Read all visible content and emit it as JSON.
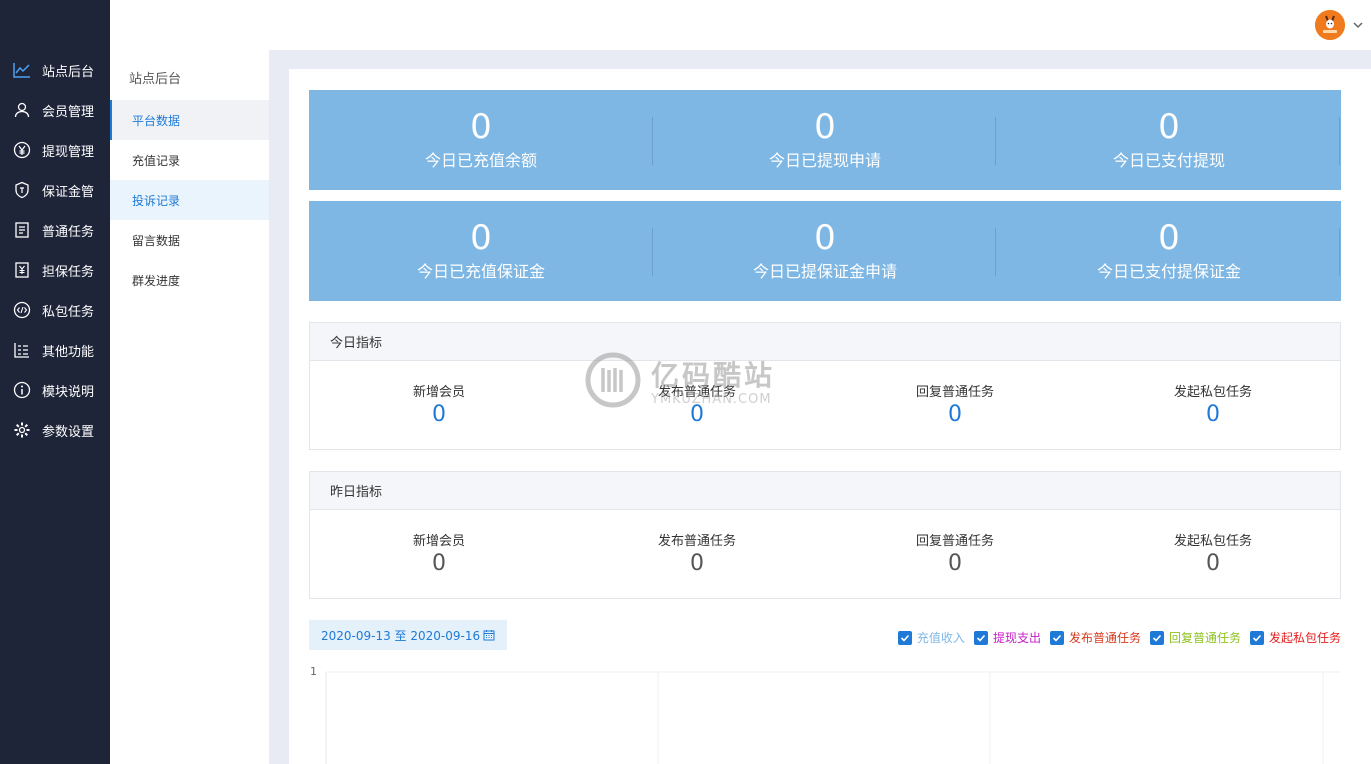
{
  "sidebar": {
    "items": [
      {
        "label": "站点后台",
        "icon": "chart-line-icon"
      },
      {
        "label": "会员管理",
        "icon": "user-icon"
      },
      {
        "label": "提现管理",
        "icon": "yen-circle-icon"
      },
      {
        "label": "保证金管",
        "icon": "shield-icon"
      },
      {
        "label": "普通任务",
        "icon": "receipt-icon"
      },
      {
        "label": "担保任务",
        "icon": "yen-receipt-icon"
      },
      {
        "label": "私包任务",
        "icon": "code-circle-icon"
      },
      {
        "label": "其他功能",
        "icon": "list-icon"
      },
      {
        "label": "模块说明",
        "icon": "info-circle-icon"
      },
      {
        "label": "参数设置",
        "icon": "gear-icon"
      }
    ]
  },
  "subnav": {
    "title": "站点后台",
    "items": [
      "平台数据",
      "充值记录",
      "投诉记录",
      "留言数据",
      "群发进度"
    ]
  },
  "stats_row1": [
    {
      "value": "0",
      "caption": "今日已充值余额"
    },
    {
      "value": "0",
      "caption": "今日已提现申请"
    },
    {
      "value": "0",
      "caption": "今日已支付提现"
    }
  ],
  "stats_row2": [
    {
      "value": "0",
      "caption": "今日已充值保证金"
    },
    {
      "value": "0",
      "caption": "今日已提保证金申请"
    },
    {
      "value": "0",
      "caption": "今日已支付提保证金"
    }
  ],
  "today": {
    "title": "今日指标",
    "metrics": [
      {
        "label": "新增会员",
        "value": "0"
      },
      {
        "label": "发布普通任务",
        "value": "0"
      },
      {
        "label": "回复普通任务",
        "value": "0"
      },
      {
        "label": "发起私包任务",
        "value": "0"
      }
    ]
  },
  "yesterday": {
    "title": "昨日指标",
    "metrics": [
      {
        "label": "新增会员",
        "value": "0"
      },
      {
        "label": "发布普通任务",
        "value": "0"
      },
      {
        "label": "回复普通任务",
        "value": "0"
      },
      {
        "label": "发起私包任务",
        "value": "0"
      }
    ]
  },
  "date_range": "2020-09-13 至 2020-09-16",
  "legend": [
    {
      "label": "充值收入",
      "color": "#7fb7e4"
    },
    {
      "label": "提现支出",
      "color": "#c41ec4"
    },
    {
      "label": "发布普通任务",
      "color": "#d63a1e"
    },
    {
      "label": "回复普通任务",
      "color": "#8dc21f"
    },
    {
      "label": "发起私包任务",
      "color": "#e61e1e"
    }
  ],
  "chart": {
    "y_tick": "1"
  },
  "watermark": {
    "cn": "亿码酷站",
    "en": "YMKUZHAN.COM"
  },
  "colors": {
    "sidebar_bg": "#1e2539",
    "accent": "#1e7ad6",
    "stat_band": "#7fb7e4"
  }
}
